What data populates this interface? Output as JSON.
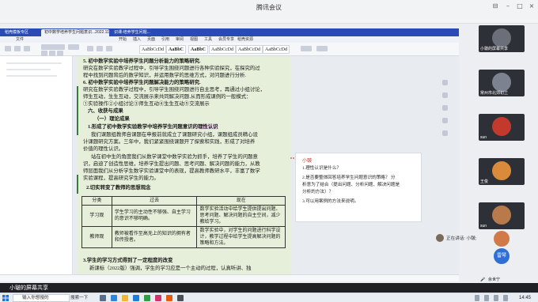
{
  "meeting": {
    "title": "腾讯会议"
  },
  "tabs": [
    {
      "label": "稻壳模板专区"
    },
    {
      "label": "初中数学培养学生问题意识...2022.11.28"
    },
    {
      "label": "识课-培养学生问题..."
    }
  ],
  "menu": [
    "文件",
    "开始",
    "插入",
    "页面",
    "引用",
    "审阅",
    "视图",
    "工具",
    "会员专享",
    "稻壳资源"
  ],
  "styles": [
    "AaBbCcDd",
    "AaBbC",
    "AaBbC",
    "AaBbCcDd",
    "AaBbCcDd",
    "AaBbCcDd"
  ],
  "doc": {
    "lines": [
      {
        "text": "5. 初中数学实验中培养学生问题分析能力的策略研究.",
        "bold": true
      },
      {
        "text": "研究在数学实验教学过程中，引导学生围绕问题进行各种实验探究，在探究的过"
      },
      {
        "text": "程中找到问题背后的数学知识，并运用数学的思维方式，对问题进行分析."
      },
      {
        "text": "6. 初中数学实验中培养学生问题解决能力的策略研究.",
        "bold": true
      },
      {
        "text": "研究在数学实验教学过程中，引导学生围绕问题进行自主思考，再通过小组讨论，"
      },
      {
        "text": "师生互动，生生互动，交流展示来共同解决问题.从而形成课例的一般模式："
      },
      {
        "text": "①实验操作②小组讨论③师生互动④生生互动⑤交流展示"
      },
      {
        "text": "六、收获与成果",
        "bold": true
      },
      {
        "text": "（一）理论成果",
        "bold": true
      },
      {
        "text": "1.形成了初中数学实验教学中培养学生问题意识的",
        "bold": true,
        "highlight": "理性认识"
      },
      {
        "text": "我们课题组教师自课题在申报前就成立了课题研究小组，课题组成员精心设"
      },
      {
        "text": "计课题研究方案。三年中，我们紧紧围绕课题开了探索和实践，形成了对培养"
      },
      {
        "text": "价值的理性认识。"
      },
      {
        "text": "站在初中生的角度我们从数学课堂中数学实验为抓手，培养了学生的问题意"
      },
      {
        "text": "识，启迪了创造性思维，培养学生提出问题、思考问题、解决问题的能力，从教"
      },
      {
        "text": "师层面我们从分析学生数学实验课堂中的表现，提高教师教研水平，丰富了数学"
      },
      {
        "text": "实验课程，提高研究学生的能力。"
      },
      {
        "text": "2.切实转变了教师的思想观念",
        "bold": true
      }
    ],
    "table": {
      "headers": [
        "分类",
        "过去",
        "现在"
      ],
      "rows": [
        {
          "cat": "学习观",
          "past": "学生学习的主动性不够强、自主学习的意识不够明确。",
          "now": "数学实验活动中给学生提供提出问题、思考问题、解决问题的自主空间，减少教给学习。"
        },
        {
          "cat": "教师观",
          "past": "教师被看作至高无上的知识的拥有者和传授者。",
          "now": "数学实验中，对学生的问题进行科学设计，教学过程中给学生提高解决问题的策略和方法。"
        }
      ]
    },
    "after_lines": [
      {
        "text": "3.学生的学习方式得到了一定程度的改变",
        "bold": true
      },
      {
        "text": "新课标（2022版）强调，学生的学习应是一个主动的过程，认真听讲、独"
      }
    ]
  },
  "comment": {
    "author": "小皲",
    "lines": [
      "1.理性认识是什么？",
      "2.是否要整体回答培养学生问题意识的策略？ 分",
      "析意为了结合（提出问题、分析问题、解决问题是",
      "分析的方法）？",
      "3.可以用案例的方法来说明。"
    ]
  },
  "participants": [
    {
      "name": "小皲的屏幕共享",
      "color": "#6a6f79"
    },
    {
      "name": "常州市北郊初兰",
      "color": "#7d8290"
    },
    {
      "name": "sun",
      "color": "#c3392b"
    },
    {
      "name": "王俊",
      "color": "#d98a3a"
    },
    {
      "name": "sun",
      "color": "#b87a4a"
    },
    {
      "name": "…",
      "color": "#d07a4a"
    },
    {
      "name": "雷琴",
      "color": "#2f6ed3",
      "avatar_text": "雷琴"
    },
    {
      "name": "余世宁",
      "color": "#4a4f59"
    }
  ],
  "speaking": {
    "label": "正在讲话: 小皲;"
  },
  "share_footer": {
    "label": "小皲的屏幕共享"
  },
  "taskbar": {
    "search_placeholder": "输入你想搜的",
    "search_button": "搜索一下",
    "clock": "14:45"
  }
}
